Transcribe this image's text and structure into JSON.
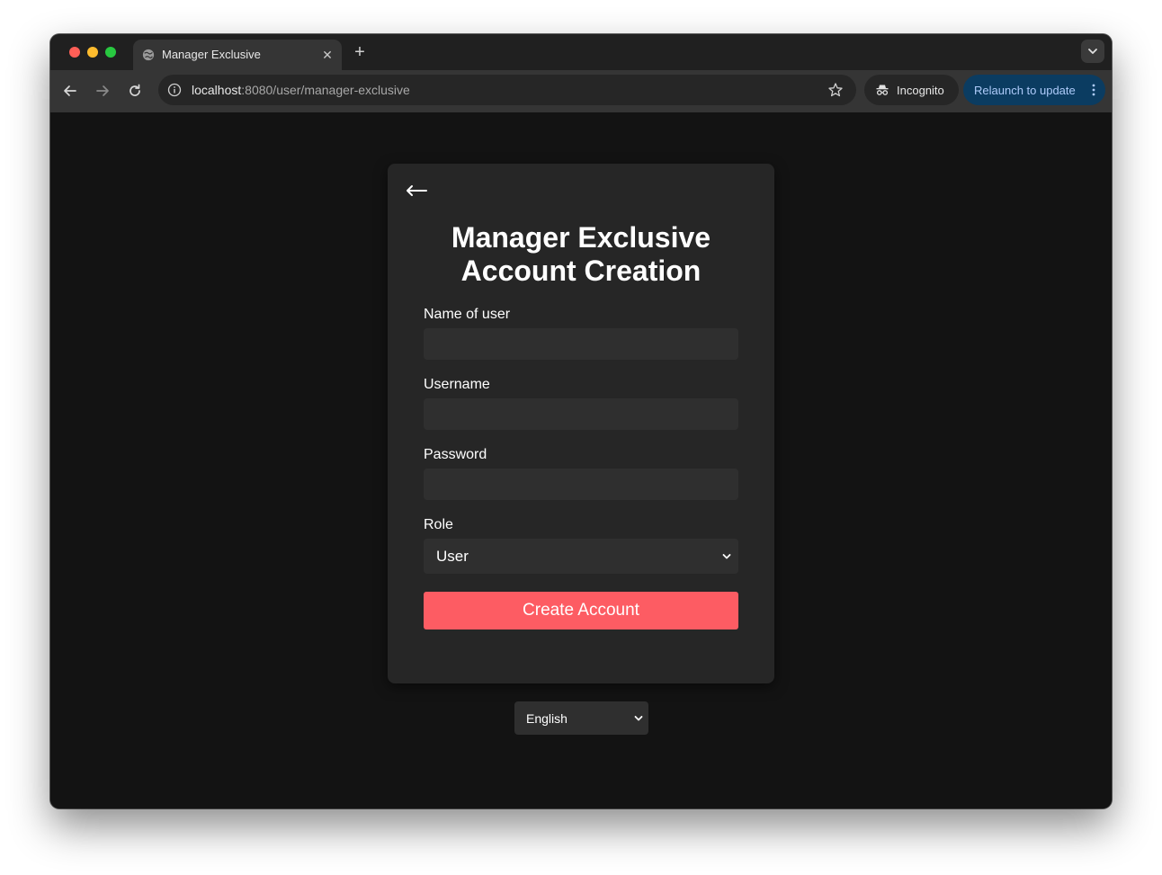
{
  "browser": {
    "tab": {
      "title": "Manager Exclusive",
      "close_symbol": "✕"
    },
    "new_tab_symbol": "+",
    "address_bar": {
      "host": "localhost",
      "path": ":8080/user/manager-exclusive"
    },
    "incognito_label": "Incognito",
    "relaunch_label": "Relaunch to update"
  },
  "page": {
    "title_line1": "Manager Exclusive",
    "title_line2": "Account Creation",
    "fields": {
      "name": {
        "label": "Name of user",
        "value": ""
      },
      "username": {
        "label": "Username",
        "value": ""
      },
      "password": {
        "label": "Password",
        "value": ""
      },
      "role": {
        "label": "Role",
        "selected": "User"
      }
    },
    "submit_label": "Create Account",
    "language": {
      "selected": "English"
    }
  },
  "colors": {
    "accent": "#fd5c63",
    "card_bg": "#262626",
    "page_bg": "#131313",
    "relaunch_bg": "#0b3c61"
  },
  "icons": {
    "back": "arrow-left-icon",
    "favicon": "globe-icon",
    "star": "star-icon",
    "info": "info-icon",
    "incognito": "incognito-icon"
  }
}
